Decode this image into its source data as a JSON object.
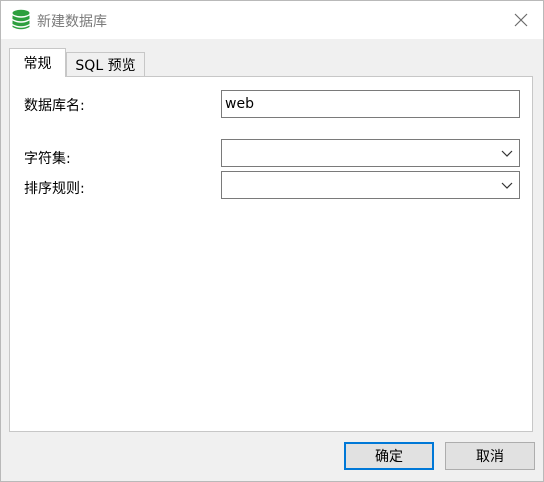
{
  "window": {
    "title": "新建数据库",
    "icon": "database-icon",
    "close_icon": "close-icon"
  },
  "tabs": [
    {
      "label": "常规",
      "active": true
    },
    {
      "label": "SQL 预览",
      "active": false
    }
  ],
  "form": {
    "db_name_label": "数据库名:",
    "db_name_value": "web",
    "charset_label": "字符集:",
    "charset_value": "",
    "collation_label": "排序规则:",
    "collation_value": ""
  },
  "buttons": {
    "ok_label": "确定",
    "cancel_label": "取消"
  },
  "colors": {
    "icon_green": "#2e9f3e",
    "default_button_border": "#0078d7"
  }
}
